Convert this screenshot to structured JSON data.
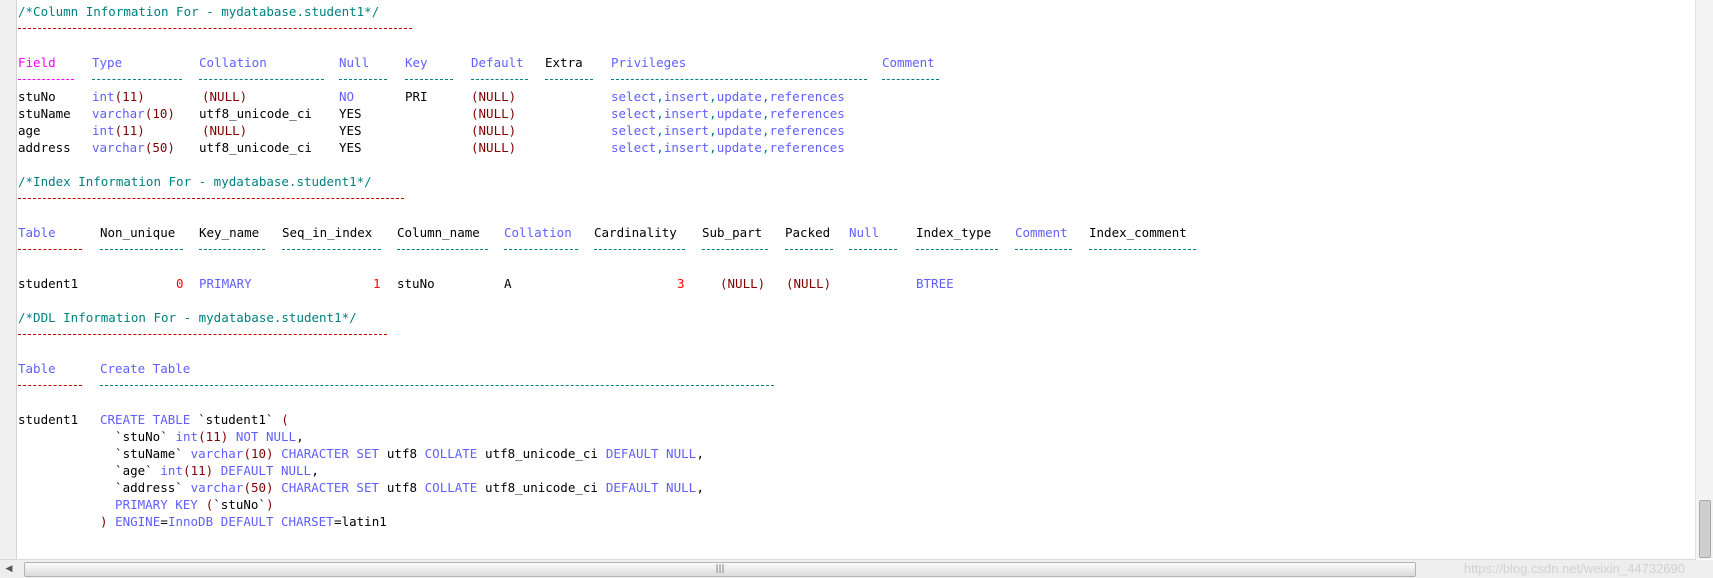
{
  "sections": {
    "column_info": {
      "comment": "/*Column Information For - mydatabase.student1*/",
      "headers": [
        "Field",
        "Type",
        "Collation",
        "Null",
        "Key",
        "Default",
        "Extra",
        "Privileges",
        "Comment"
      ],
      "rows": [
        {
          "field": "stuNo",
          "type_name": "int",
          "type_len": "(11)",
          "collation": "(NULL)",
          "null": "NO",
          "key": "PRI",
          "default": "(NULL)",
          "extra": "",
          "privileges": [
            "select",
            "insert",
            "update",
            "references"
          ],
          "comment": ""
        },
        {
          "field": "stuName",
          "type_name": "varchar",
          "type_len": "(10)",
          "collation": "utf8_unicode_ci",
          "null": "YES",
          "key": "",
          "default": "(NULL)",
          "extra": "",
          "privileges": [
            "select",
            "insert",
            "update",
            "references"
          ],
          "comment": ""
        },
        {
          "field": "age",
          "type_name": "int",
          "type_len": "(11)",
          "collation": "(NULL)",
          "null": "YES",
          "key": "",
          "default": "(NULL)",
          "extra": "",
          "privileges": [
            "select",
            "insert",
            "update",
            "references"
          ],
          "comment": ""
        },
        {
          "field": "address",
          "type_name": "varchar",
          "type_len": "(50)",
          "collation": "utf8_unicode_ci",
          "null": "YES",
          "key": "",
          "default": "(NULL)",
          "extra": "",
          "privileges": [
            "select",
            "insert",
            "update",
            "references"
          ],
          "comment": ""
        }
      ]
    },
    "index_info": {
      "comment": "/*Index Information For - mydatabase.student1*/",
      "headers": [
        "Table",
        "Non_unique",
        "Key_name",
        "Seq_in_index",
        "Column_name",
        "Collation",
        "Cardinality",
        "Sub_part",
        "Packed",
        "Null",
        "Index_type",
        "Comment",
        "Index_comment"
      ],
      "row": {
        "table": "student1",
        "non_unique": "0",
        "key_name": "PRIMARY",
        "seq_in_index": "1",
        "column_name": "stuNo",
        "collation": "A",
        "cardinality": "3",
        "sub_part": "(NULL)",
        "packed": "(NULL)",
        "null": "",
        "index_type": "BTREE",
        "comment": "",
        "index_comment": ""
      }
    },
    "ddl_info": {
      "comment": "/*DDL Information For - mydatabase.student1*/",
      "headers": [
        "Table",
        "Create Table"
      ],
      "table": "student1",
      "lines": [
        [
          {
            "t": "CREATE TABLE ",
            "c": "kw"
          },
          {
            "t": "`student1` ",
            "c": "txt"
          },
          {
            "t": "(",
            "c": "paren"
          }
        ],
        [
          {
            "t": "  `stuNo` ",
            "c": "txt"
          },
          {
            "t": "int",
            "c": "kw"
          },
          {
            "t": "(11)",
            "c": "paren"
          },
          {
            "t": " NOT NULL",
            "c": "kw"
          },
          {
            "t": ",",
            "c": "txt"
          }
        ],
        [
          {
            "t": "  `stuName` ",
            "c": "txt"
          },
          {
            "t": "varchar",
            "c": "kw"
          },
          {
            "t": "(10)",
            "c": "paren"
          },
          {
            "t": " CHARACTER SET ",
            "c": "kw"
          },
          {
            "t": "utf8 ",
            "c": "txt"
          },
          {
            "t": "COLLATE ",
            "c": "kw"
          },
          {
            "t": "utf8_unicode_ci ",
            "c": "txt"
          },
          {
            "t": "DEFAULT NULL",
            "c": "kw"
          },
          {
            "t": ",",
            "c": "txt"
          }
        ],
        [
          {
            "t": "  `age` ",
            "c": "txt"
          },
          {
            "t": "int",
            "c": "kw"
          },
          {
            "t": "(11)",
            "c": "paren"
          },
          {
            "t": " DEFAULT NULL",
            "c": "kw"
          },
          {
            "t": ",",
            "c": "txt"
          }
        ],
        [
          {
            "t": "  `address` ",
            "c": "txt"
          },
          {
            "t": "varchar",
            "c": "kw"
          },
          {
            "t": "(50)",
            "c": "paren"
          },
          {
            "t": " CHARACTER SET ",
            "c": "kw"
          },
          {
            "t": "utf8 ",
            "c": "txt"
          },
          {
            "t": "COLLATE ",
            "c": "kw"
          },
          {
            "t": "utf8_unicode_ci ",
            "c": "txt"
          },
          {
            "t": "DEFAULT NULL",
            "c": "kw"
          },
          {
            "t": ",",
            "c": "txt"
          }
        ],
        [
          {
            "t": "  PRIMARY KEY ",
            "c": "kw"
          },
          {
            "t": "(",
            "c": "paren"
          },
          {
            "t": "`stuNo`",
            "c": "txt"
          },
          {
            "t": ")",
            "c": "paren"
          }
        ],
        [
          {
            "t": ")",
            "c": "paren"
          },
          {
            "t": " ENGINE",
            "c": "kw"
          },
          {
            "t": "=",
            "c": "txt"
          },
          {
            "t": "InnoDB ",
            "c": "kw"
          },
          {
            "t": "DEFAULT CHARSET",
            "c": "kw"
          },
          {
            "t": "=",
            "c": "txt"
          },
          {
            "t": "latin1",
            "c": "txt"
          }
        ]
      ]
    }
  },
  "scrollbar": {
    "grip": "|||",
    "left_arrow": "◀"
  },
  "watermark": "https://blog.csdn.net/weixin_44732690",
  "colors": {
    "comment": "#008080",
    "separator": "#c00000",
    "keyword": "#5f5fff",
    "paren": "#800000",
    "number": "#ff0000",
    "null": "#800080",
    "field_header": "#ff00ff"
  }
}
